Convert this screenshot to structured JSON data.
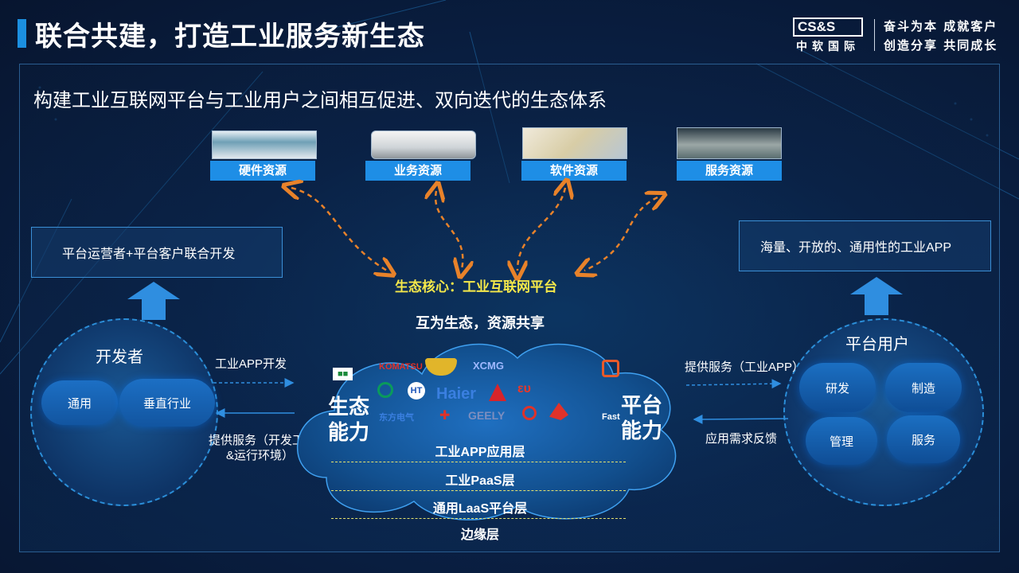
{
  "header": {
    "title": "联合共建，打造工业服务新生态",
    "logo_top": "CS&S",
    "logo_bottom": "中软国际",
    "slogan_line1": "奋斗为本 成就客户",
    "slogan_line2": "创造分享 共同成长"
  },
  "subtitle": "构建工业互联网平台与工业用户之间相互促进、双向迭代的生态体系",
  "resources": [
    "硬件资源",
    "业务资源",
    "软件资源",
    "服务资源"
  ],
  "core": {
    "title": "生态核心：工业互联网平台",
    "share": "互为生态，资源共享",
    "left_cap_1": "生态",
    "left_cap_2": "能力",
    "right_cap_1": "平台",
    "right_cap_2": "能力",
    "layers": [
      "工业APP应用层",
      "工业PaaS层",
      "通用LaaS平台层",
      "边缘层"
    ]
  },
  "partner_logos": [
    "KOMATSU",
    "XCMG",
    "Haier",
    "GEELY",
    "Fast",
    "东方电气"
  ],
  "left": {
    "box_text": "平台运营者+平台客户联合开发",
    "circle_title": "开发者",
    "items": [
      "通用",
      "垂直行业"
    ],
    "arrow_out_label": "工业APP开发",
    "arrow_in_label_1": "提供服务（开发工具",
    "arrow_in_label_2": "&运行环境）"
  },
  "right": {
    "box_text": "海量、开放的、通用性的工业APP",
    "circle_title": "平台用户",
    "items": [
      "研发",
      "制造",
      "管理",
      "服务"
    ],
    "arrow_in_label": "提供服务（工业APP）",
    "arrow_out_label": "应用需求反馈"
  },
  "colors": {
    "accent": "#1e8ee6",
    "core_title": "#f5e84a",
    "arrow_orange": "#e8822a"
  }
}
